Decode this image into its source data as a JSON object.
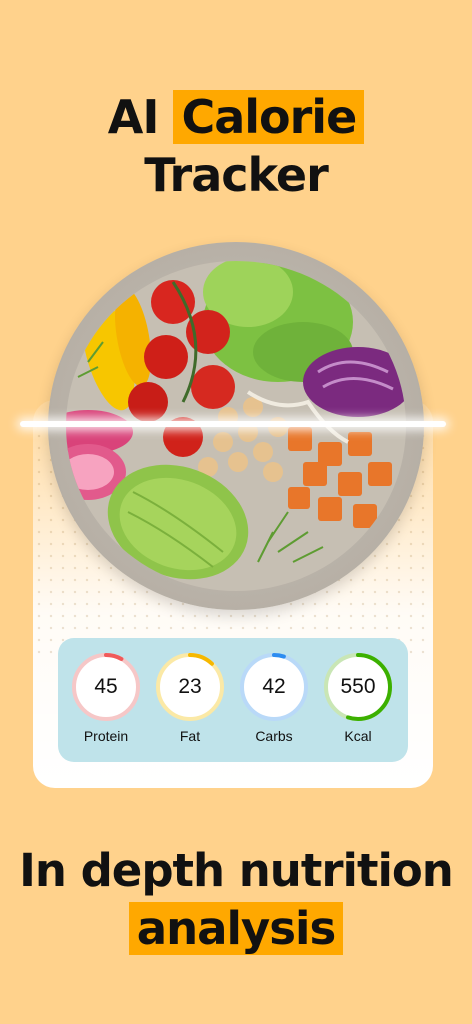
{
  "header": {
    "title_part1": "AI",
    "title_highlight": "Calorie",
    "title_part2": "Tracker"
  },
  "macros": [
    {
      "value": "45",
      "label": "Protein",
      "color": "#F05A5A",
      "track": "#F6C7C7",
      "progress": 0.08
    },
    {
      "value": "23",
      "label": "Fat",
      "color": "#F6B800",
      "track": "#FBE9A6",
      "progress": 0.12
    },
    {
      "value": "42",
      "label": "Carbs",
      "color": "#2D8CF0",
      "track": "#B9D9F8",
      "progress": 0.05
    },
    {
      "value": "550",
      "label": "Kcal",
      "color": "#3CB000",
      "track": "#C9E6B5",
      "progress": 0.55
    }
  ],
  "tagline": {
    "line1": "In depth nutrition",
    "line2_highlight": "analysis"
  },
  "colors": {
    "background": "#FFD28C",
    "highlight": "#FFA800",
    "macro_panel": "#BFE3EA"
  }
}
